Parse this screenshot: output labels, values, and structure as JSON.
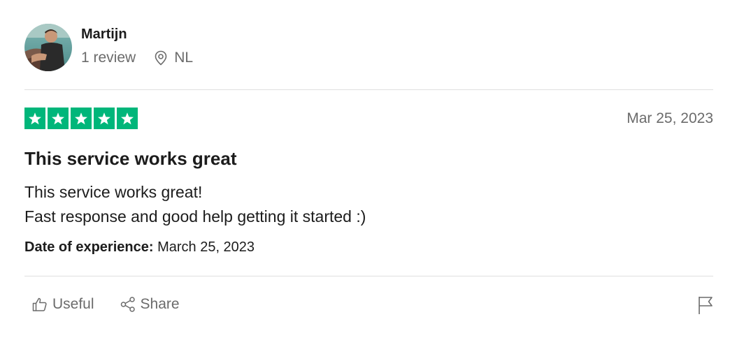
{
  "consumer": {
    "name": "Martijn",
    "reviews_count": "1 review",
    "country": "NL"
  },
  "review": {
    "rating": 5,
    "date": "Mar 25, 2023",
    "title": "This service works great",
    "body_lines": [
      "This service works great!",
      "Fast response and good help getting it started :)"
    ],
    "experience_label": "Date of experience:",
    "experience_date": "March 25, 2023"
  },
  "actions": {
    "useful_label": "Useful",
    "share_label": "Share"
  },
  "icons": {
    "location": "location-pin-icon",
    "useful": "thumbs-up-icon",
    "share": "share-icon",
    "flag": "flag-icon",
    "star": "star-icon"
  },
  "colors": {
    "star_bg": "#00b67a",
    "muted_text": "#6b6b6b",
    "main_text": "#1c1c1c"
  }
}
